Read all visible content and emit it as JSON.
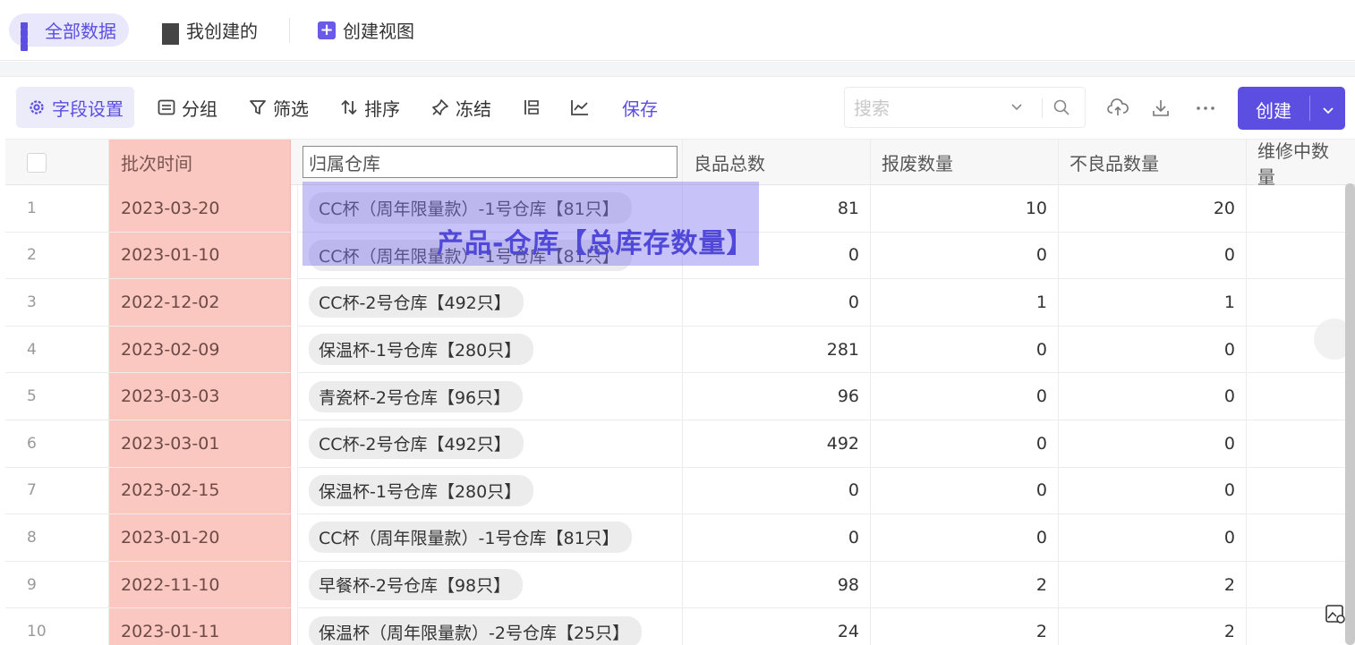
{
  "views": {
    "all": "全部数据",
    "mine": "我创建的",
    "create_view": "创建视图"
  },
  "toolbar": {
    "fields": "字段设置",
    "group": "分组",
    "filter": "筛选",
    "sort": "排序",
    "freeze": "冻结",
    "save": "保存",
    "search_placeholder": "搜索",
    "create": "创建"
  },
  "table": {
    "columns": [
      "批次时间",
      "归属仓库",
      "良品总数",
      "报废数量",
      "不良品数量",
      "维修中数量"
    ],
    "rows": [
      {
        "idx": "1",
        "date": "2023-03-20",
        "warehouse": "CC杯（周年限量款）-1号仓库【81只】",
        "good": "81",
        "scrap": "10",
        "bad": "20",
        "repair": ""
      },
      {
        "idx": "2",
        "date": "2023-01-10",
        "warehouse": "CC杯（周年限量款）-1号仓库【81只】",
        "good": "0",
        "scrap": "0",
        "bad": "0",
        "repair": ""
      },
      {
        "idx": "3",
        "date": "2022-12-02",
        "warehouse": "CC杯-2号仓库【492只】",
        "good": "0",
        "scrap": "1",
        "bad": "1",
        "repair": ""
      },
      {
        "idx": "4",
        "date": "2023-02-09",
        "warehouse": "保温杯-1号仓库【280只】",
        "good": "281",
        "scrap": "0",
        "bad": "0",
        "repair": ""
      },
      {
        "idx": "5",
        "date": "2023-03-03",
        "warehouse": "青瓷杯-2号仓库【96只】",
        "good": "96",
        "scrap": "0",
        "bad": "0",
        "repair": ""
      },
      {
        "idx": "6",
        "date": "2023-03-01",
        "warehouse": "CC杯-2号仓库【492只】",
        "good": "492",
        "scrap": "0",
        "bad": "0",
        "repair": ""
      },
      {
        "idx": "7",
        "date": "2023-02-15",
        "warehouse": "保温杯-1号仓库【280只】",
        "good": "0",
        "scrap": "0",
        "bad": "0",
        "repair": ""
      },
      {
        "idx": "8",
        "date": "2023-01-20",
        "warehouse": "CC杯（周年限量款）-1号仓库【81只】",
        "good": "0",
        "scrap": "0",
        "bad": "0",
        "repair": ""
      },
      {
        "idx": "9",
        "date": "2022-11-10",
        "warehouse": "早餐杯-2号仓库【98只】",
        "good": "98",
        "scrap": "2",
        "bad": "2",
        "repair": ""
      },
      {
        "idx": "10",
        "date": "2023-01-11",
        "warehouse": "保温杯（周年限量款）-2号仓库【25只】",
        "good": "24",
        "scrap": "2",
        "bad": "2",
        "repair": ""
      }
    ]
  },
  "overlay_label": "产品-仓库【总库存数量】",
  "colors": {
    "accent": "#5b4ee0",
    "date_column": "#fac8c0"
  }
}
